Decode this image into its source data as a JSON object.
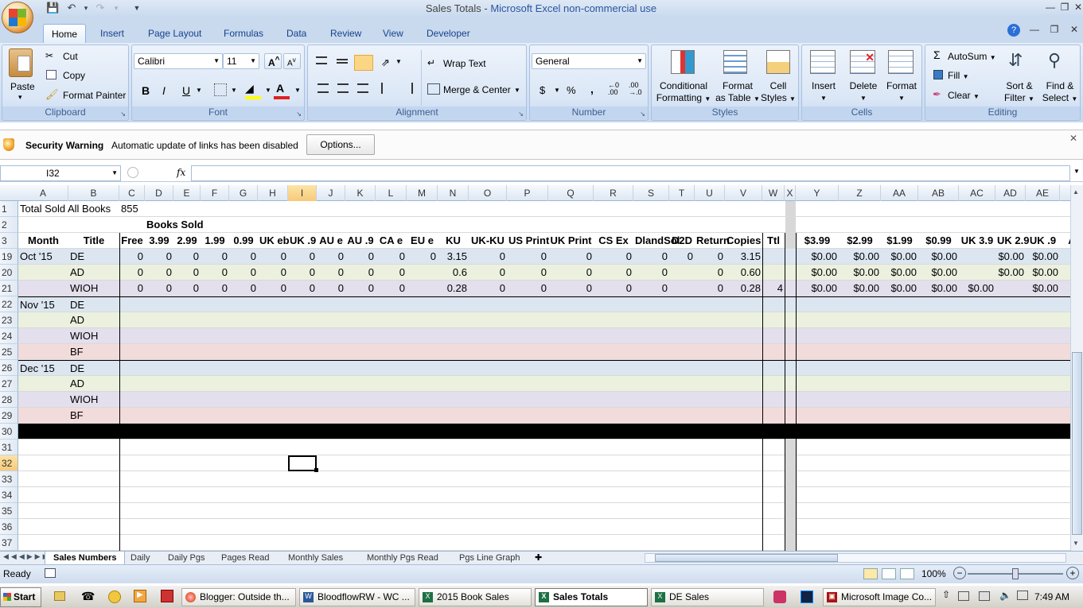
{
  "window": {
    "doc": "Sales Totals",
    "sep": " - ",
    "app": "Microsoft Excel non-commercial use"
  },
  "tabs": [
    "Home",
    "Insert",
    "Page Layout",
    "Formulas",
    "Data",
    "Review",
    "View",
    "Developer"
  ],
  "clipboard": {
    "paste": "Paste",
    "cut": "Cut",
    "copy": "Copy",
    "painter": "Format Painter",
    "title": "Clipboard"
  },
  "font": {
    "name": "Calibri",
    "size": "11",
    "title": "Font",
    "bold": "B",
    "italic": "I",
    "underline": "U"
  },
  "alignment": {
    "wrap": "Wrap Text",
    "merge": "Merge & Center",
    "title": "Alignment"
  },
  "number": {
    "format": "General",
    "currency": "$",
    "percent": "%",
    "comma": ",",
    "title": "Number"
  },
  "styles": {
    "cond1": "Conditional",
    "cond2": "Formatting",
    "fmt1": "Format",
    "fmt2": "as Table",
    "cell1": "Cell",
    "cell2": "Styles",
    "title": "Styles"
  },
  "cells": {
    "insert": "Insert",
    "delete": "Delete",
    "format": "Format",
    "title": "Cells"
  },
  "editing": {
    "autosum": "AutoSum",
    "fill": "Fill",
    "clear": "Clear",
    "sort1": "Sort &",
    "sort2": "Filter",
    "find1": "Find &",
    "find2": "Select",
    "title": "Editing"
  },
  "security": {
    "label": "Security Warning",
    "message": "Automatic update of links has been disabled",
    "button": "Options..."
  },
  "formula": {
    "namebox": "I32",
    "fx": "fx",
    "value": ""
  },
  "columns": [
    "A",
    "B",
    "C",
    "D",
    "E",
    "F",
    "G",
    "H",
    "I",
    "J",
    "K",
    "L",
    "M",
    "N",
    "O",
    "P",
    "Q",
    "R",
    "S",
    "T",
    "U",
    "V",
    "W",
    "X",
    "Y",
    "Z",
    "AA",
    "AB",
    "AC",
    "AD",
    "AE"
  ],
  "rows": {
    "r1": {
      "num": "1",
      "a": "Total Sold All Books",
      "c": "855"
    },
    "r2": {
      "num": "2",
      "d": "Books Sold"
    },
    "r3": {
      "num": "3",
      "cells": [
        "Month",
        "Title",
        "Free",
        "3.99",
        "2.99",
        "1.99",
        "0.99",
        "UK eb",
        "UK .9",
        "AU e",
        "AU .9",
        "CA e",
        "EU e",
        "KU",
        "UK-KU",
        "US Print",
        "UK Print",
        "CS Ex",
        "DlandSol",
        "D2D",
        "Return",
        "Copies",
        "Ttl",
        "",
        "$3.99",
        "$2.99",
        "$1.99",
        "$0.99",
        "UK 3.9",
        "UK 2.9",
        "UK .9",
        "A"
      ]
    },
    "r19": {
      "num": "19",
      "cells": [
        "Oct '15",
        "DE",
        "0",
        "0",
        "0",
        "0",
        "0",
        "0",
        "0",
        "0",
        "0",
        "0",
        "0",
        "3.15",
        "0",
        "0",
        "0",
        "0",
        "0",
        "0",
        "0",
        "3.15",
        "",
        "",
        "$0.00",
        "$0.00",
        "$0.00",
        "$0.00",
        "",
        "$0.00",
        "$0.00"
      ]
    },
    "r20": {
      "num": "20",
      "cells": [
        "",
        "AD",
        "0",
        "0",
        "0",
        "0",
        "0",
        "0",
        "0",
        "0",
        "0",
        "0",
        "",
        "0.6",
        "0",
        "0",
        "0",
        "0",
        "0",
        "",
        "0",
        "0.60",
        "",
        "",
        "$0.00",
        "$0.00",
        "$0.00",
        "$0.00",
        "",
        "$0.00",
        "$0.00"
      ]
    },
    "r21": {
      "num": "21",
      "cells": [
        "",
        "WIOH",
        "0",
        "0",
        "0",
        "0",
        "0",
        "0",
        "0",
        "0",
        "0",
        "0",
        "",
        "0.28",
        "0",
        "0",
        "0",
        "0",
        "0",
        "",
        "0",
        "0.28",
        "4",
        "",
        "$0.00",
        "$0.00",
        "$0.00",
        "$0.00",
        "$0.00",
        "",
        "$0.00"
      ]
    },
    "r22": {
      "num": "22",
      "a": "Nov '15",
      "b": "DE"
    },
    "r23": {
      "num": "23",
      "b": "AD"
    },
    "r24": {
      "num": "24",
      "b": "WIOH"
    },
    "r25": {
      "num": "25",
      "b": "BF"
    },
    "r26": {
      "num": "26",
      "a": "Dec '15",
      "b": "DE"
    },
    "r27": {
      "num": "27",
      "b": "AD"
    },
    "r28": {
      "num": "28",
      "b": "WIOH"
    },
    "r29": {
      "num": "29",
      "b": "BF"
    },
    "blank": [
      "30",
      "31",
      "32",
      "33",
      "34",
      "35",
      "36",
      "37"
    ]
  },
  "sheets": [
    "Sales Numbers",
    "Daily",
    "Daily Pgs",
    "Pages Read",
    "Monthly Sales",
    "Monthly Pgs Read",
    "Pgs Line Graph"
  ],
  "status": {
    "ready": "Ready",
    "zoom": "100%"
  },
  "taskbar": {
    "start": "Start",
    "items": [
      "Blogger: Outside th...",
      "BloodflowRW - WC ...",
      "2015 Book Sales",
      "Sales Totals",
      "DE Sales",
      "Microsoft Image Co..."
    ],
    "time": "7:49 AM"
  },
  "colors": {
    "blue": "#dce6f1",
    "green": "#ebf1de",
    "purple": "#e4dfec",
    "red": "#f2dcdb",
    "accent": "#15428b"
  }
}
